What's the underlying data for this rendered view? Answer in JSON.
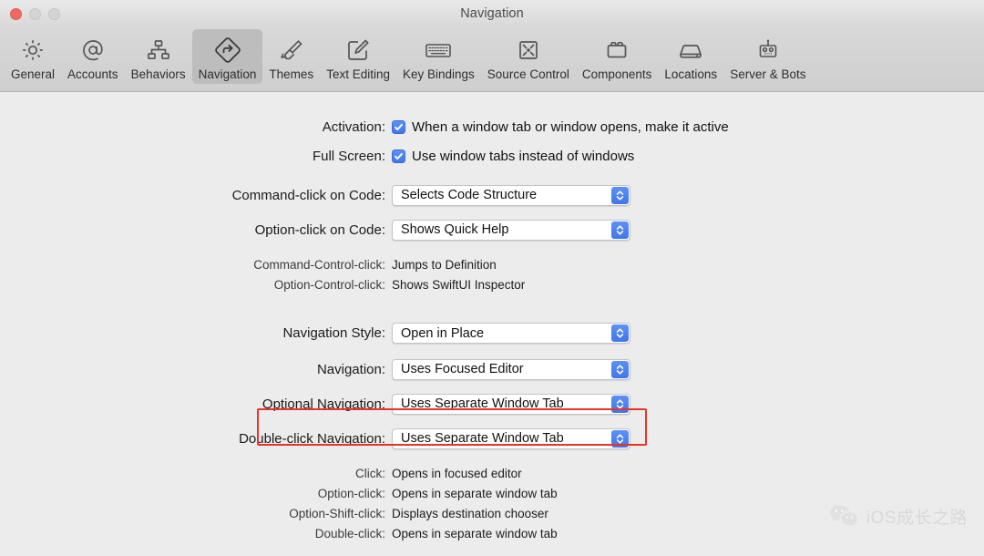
{
  "window": {
    "title": "Navigation",
    "traffic_lights": [
      "close-button",
      "minimize-button",
      "maximize-button"
    ],
    "colors": {
      "close": "#ee6a5f",
      "inactive": "#d4d4d4",
      "accent": "#3f76ee",
      "annotation": "#e8342a",
      "content_bg": "#ececec",
      "toolbar_bg": "#d4d4d4"
    }
  },
  "toolbar": {
    "items": [
      {
        "label": "General",
        "icon": "gear-icon"
      },
      {
        "label": "Accounts",
        "icon": "at-sign-icon"
      },
      {
        "label": "Behaviors",
        "icon": "hierarchy-icon"
      },
      {
        "label": "Navigation",
        "icon": "navigation-arrow-icon"
      },
      {
        "label": "Themes",
        "icon": "paintbrush-icon"
      },
      {
        "label": "Text Editing",
        "icon": "pencil-square-icon"
      },
      {
        "label": "Key Bindings",
        "icon": "keyboard-icon"
      },
      {
        "label": "Source Control",
        "icon": "merge-box-icon"
      },
      {
        "label": "Components",
        "icon": "lego-brick-icon"
      },
      {
        "label": "Locations",
        "icon": "hard-drive-icon"
      },
      {
        "label": "Server & Bots",
        "icon": "robot-icon"
      }
    ],
    "selected_index": 3
  },
  "form": {
    "checkbox_rows": [
      {
        "label": "Activation:",
        "text": "When a window tab or window opens, make it active",
        "checked": true
      },
      {
        "label": "Full Screen:",
        "text": "Use window tabs instead of windows",
        "checked": true
      }
    ],
    "popup_rows_top": [
      {
        "label": "Command-click on Code:",
        "value": "Selects Code Structure"
      },
      {
        "label": "Option-click on Code:",
        "value": "Shows Quick Help"
      }
    ],
    "static_rows_top": [
      {
        "label": "Command-Control-click:",
        "value": "Jumps to Definition"
      },
      {
        "label": "Option-Control-click:",
        "value": "Shows SwiftUI Inspector"
      }
    ],
    "highlighted_row": {
      "label": "Navigation Style:",
      "value": "Open in Place"
    },
    "popup_rows_bottom": [
      {
        "label": "Navigation:",
        "value": "Uses Focused Editor"
      },
      {
        "label": "Optional Navigation:",
        "value": "Uses Separate Window Tab"
      },
      {
        "label": "Double-click Navigation:",
        "value": "Uses Separate Window Tab"
      }
    ],
    "static_rows_bottom": [
      {
        "label": "Click:",
        "value": "Opens in focused editor"
      },
      {
        "label": "Option-click:",
        "value": "Opens in separate window tab"
      },
      {
        "label": "Option-Shift-click:",
        "value": "Displays destination chooser"
      },
      {
        "label": "Double-click:",
        "value": "Opens in separate window tab"
      }
    ]
  },
  "watermark": {
    "icon": "wechat-icon",
    "text": "iOS成长之路"
  }
}
